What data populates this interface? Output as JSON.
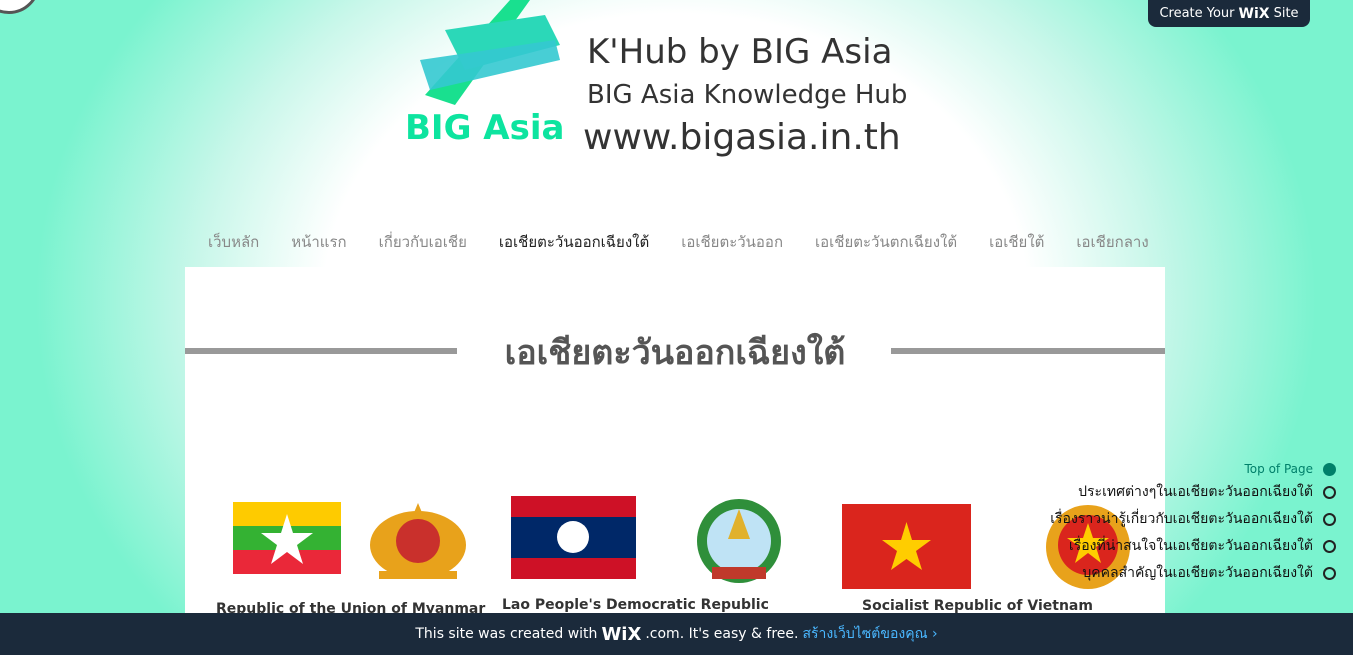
{
  "header": {
    "create_site_pre": "Create Your",
    "create_site_brand": "WiX",
    "create_site_post": "Site",
    "logo_text": "BIG Asia",
    "title": "K'Hub by BIG Asia",
    "subtitle": "BIG Asia Knowledge Hub",
    "url": "www.bigasia.in.th"
  },
  "nav": {
    "items": [
      {
        "label": "เว็บหลัก"
      },
      {
        "label": "หน้าแรก"
      },
      {
        "label": "เกี่ยวกับเอเชีย"
      },
      {
        "label": "เอเชียตะวันออกเฉียงใต้"
      },
      {
        "label": "เอเชียตะวันออก"
      },
      {
        "label": "เอเชียตะวันตกเฉียงใต้"
      },
      {
        "label": "เอเชียใต้"
      },
      {
        "label": "เอเชียกลาง"
      }
    ]
  },
  "main": {
    "title": "เอเชียตะวันออกเฉียงใต้",
    "countries": [
      {
        "name": "Republic of the Union of Myanmar"
      },
      {
        "name": "Lao People's Democratic Republic"
      },
      {
        "name": "Socialist Republic of Vietnam"
      }
    ]
  },
  "anchors": {
    "items": [
      {
        "label": "Top of Page"
      },
      {
        "label": "ประเทศต่างๆในเอเชียตะวันออกเฉียงใต้"
      },
      {
        "label": "เรื่องราวน่ารู้เกี่ยวกับเอเชียตะวันออกเฉียงใต้"
      },
      {
        "label": "เรื่องที่น่าสนใจในเอเชียตะวันออกเฉียงใต้"
      },
      {
        "label": "บุคคลสำคัญในเอเชียตะวันออกเฉียงใต้"
      }
    ]
  },
  "footer": {
    "text_pre": "This site was created with",
    "brand": "WiX",
    "text_post": ".com. It's easy & free.",
    "link": "สร้างเว็บไซต์ของคุณ ›"
  },
  "colors": {
    "accent": "#0de49f",
    "footer_bg": "#1b2a3b",
    "link": "#4ab7ff"
  }
}
